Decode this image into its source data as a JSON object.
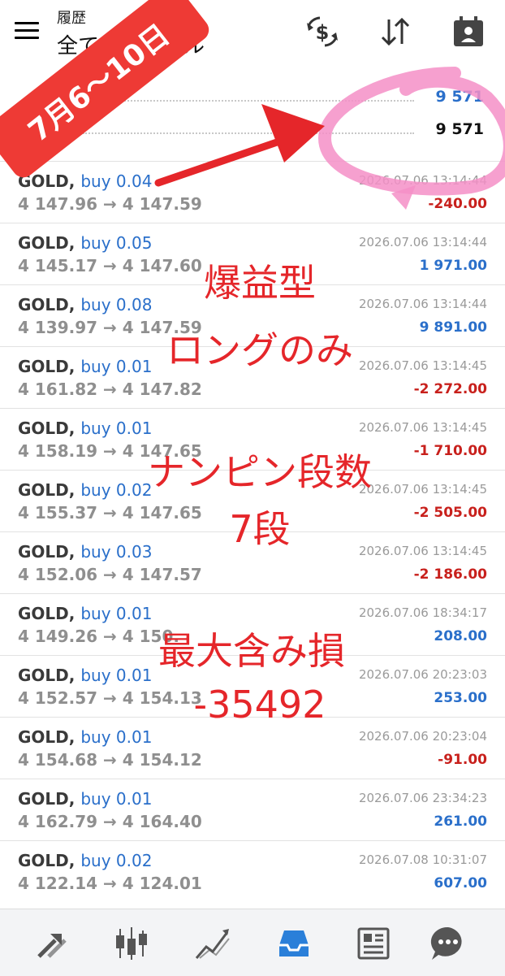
{
  "header": {
    "subtitle": "履歴",
    "title": "全てのシンボル"
  },
  "summary": {
    "row1_value": "9 571",
    "row2_label": "",
    "row2_value": "9 571"
  },
  "trades": [
    {
      "symbol": "GOLD,",
      "side": "buy 0.04",
      "prices": "4 147.96 → 4 147.59",
      "time": "2026.07.06 13:14:44",
      "profit": "-240.00",
      "neg": true
    },
    {
      "symbol": "GOLD,",
      "side": "buy 0.05",
      "prices": "4 145.17 → 4 147.60",
      "time": "2026.07.06 13:14:44",
      "profit": "1 971.00",
      "neg": false
    },
    {
      "symbol": "GOLD,",
      "side": "buy 0.08",
      "prices": "4 139.97 → 4 147.59",
      "time": "2026.07.06 13:14:44",
      "profit": "9 891.00",
      "neg": false
    },
    {
      "symbol": "GOLD,",
      "side": "buy 0.01",
      "prices": "4 161.82 → 4 147.82",
      "time": "2026.07.06 13:14:45",
      "profit": "-2 272.00",
      "neg": true
    },
    {
      "symbol": "GOLD,",
      "side": "buy 0.01",
      "prices": "4 158.19 → 4 147.65",
      "time": "2026.07.06 13:14:45",
      "profit": "-1 710.00",
      "neg": true
    },
    {
      "symbol": "GOLD,",
      "side": "buy 0.02",
      "prices": "4 155.37 → 4 147.65",
      "time": "2026.07.06 13:14:45",
      "profit": "-2 505.00",
      "neg": true
    },
    {
      "symbol": "GOLD,",
      "side": "buy 0.03",
      "prices": "4 152.06 → 4 147.57",
      "time": "2026.07.06 13:14:45",
      "profit": "-2 186.00",
      "neg": true
    },
    {
      "symbol": "GOLD,",
      "side": "buy 0.01",
      "prices": "4 149.26 → 4 150.",
      "time": "2026.07.06 18:34:17",
      "profit": "208.00",
      "neg": false
    },
    {
      "symbol": "GOLD,",
      "side": "buy 0.01",
      "prices": "4 152.57 → 4 154.13",
      "time": "2026.07.06 20:23:03",
      "profit": "253.00",
      "neg": false
    },
    {
      "symbol": "GOLD,",
      "side": "buy 0.01",
      "prices": "4 154.68 → 4 154.12",
      "time": "2026.07.06 20:23:04",
      "profit": "-91.00",
      "neg": true
    },
    {
      "symbol": "GOLD,",
      "side": "buy 0.01",
      "prices": "4 162.79 → 4 164.40",
      "time": "2026.07.06 23:34:23",
      "profit": "261.00",
      "neg": false
    },
    {
      "symbol": "GOLD,",
      "side": "buy 0.02",
      "prices": "4 122.14 → 4 124.01",
      "time": "2026.07.08 10:31:07",
      "profit": "607.00",
      "neg": false
    }
  ],
  "annotations": {
    "stamp": "7月6〜10日",
    "line1": "爆益型",
    "line2": "ロングのみ",
    "line3": "ナンピン段数",
    "line4": "7段",
    "line5": "最大含み損",
    "line6": "-35492"
  },
  "colors": {
    "accent_blue": "#2a6fca",
    "loss_red": "#c8201c",
    "annotation_red": "#e5262a",
    "highlight_pink": "#f48fc7"
  },
  "icons": {
    "menu": "hamburger-icon",
    "header": [
      "dollar-exchange-icon",
      "sort-arrows-icon",
      "calendar-person-icon"
    ],
    "nav": [
      "trade-arrows-icon",
      "candlestick-icon",
      "chart-line-icon",
      "inbox-icon",
      "news-icon",
      "chat-icon"
    ]
  }
}
